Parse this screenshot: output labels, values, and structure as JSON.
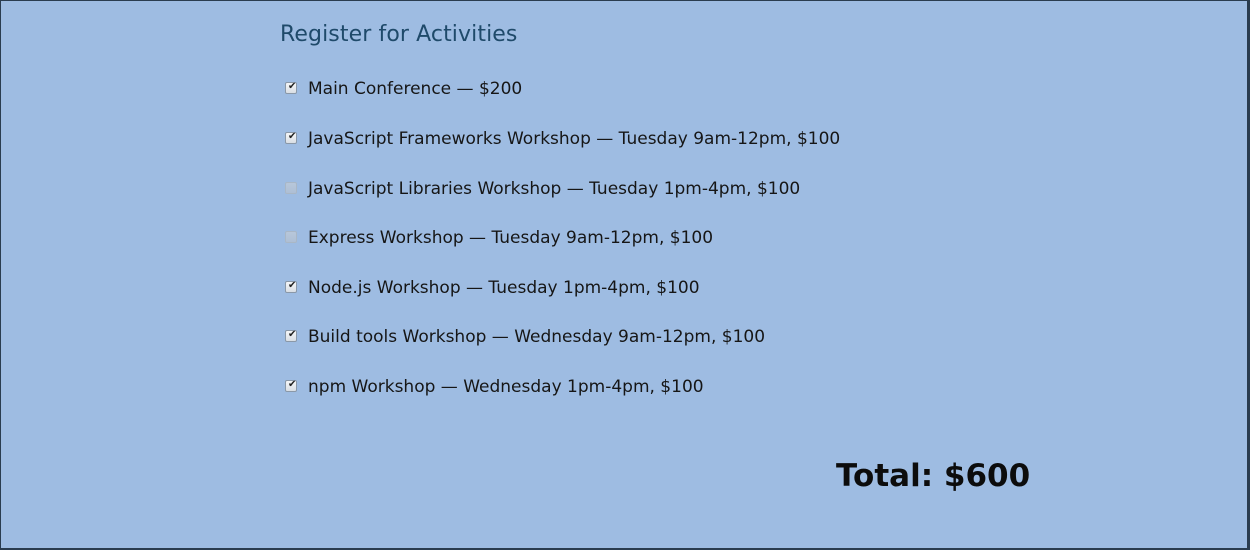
{
  "form": {
    "title": "Register for Activities",
    "activities": [
      {
        "label": "Main Conference — $200",
        "checked": true
      },
      {
        "label": "JavaScript Frameworks Workshop — Tuesday 9am-12pm, $100",
        "checked": true
      },
      {
        "label": "JavaScript Libraries Workshop — Tuesday 1pm-4pm, $100",
        "checked": false
      },
      {
        "label": "Express Workshop — Tuesday 9am-12pm, $100",
        "checked": false
      },
      {
        "label": "Node.js Workshop — Tuesday 1pm-4pm, $100",
        "checked": true
      },
      {
        "label": "Build tools Workshop — Wednesday 9am-12pm, $100",
        "checked": true
      },
      {
        "label": "npm Workshop — Wednesday 1pm-4pm, $100",
        "checked": true
      }
    ],
    "total": "Total: $600"
  },
  "colors": {
    "background": "#9ebce2",
    "title": "#1f4a6a",
    "text": "#161616"
  }
}
